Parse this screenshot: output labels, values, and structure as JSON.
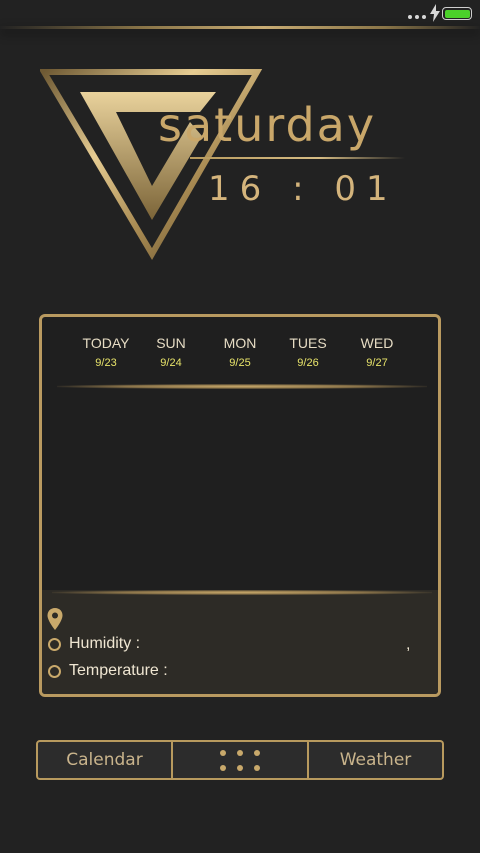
{
  "status_bar": {
    "battery_color": "#4bd12a",
    "charging_icon": "bolt-icon"
  },
  "widget": {
    "day": "saturday",
    "time": "16 : 01",
    "accent_color": "#c9a76a"
  },
  "forecast": {
    "days": [
      {
        "name": "TODAY",
        "date": "9/23"
      },
      {
        "name": "SUN",
        "date": "9/24"
      },
      {
        "name": "MON",
        "date": "9/25"
      },
      {
        "name": "TUES",
        "date": "9/26"
      },
      {
        "name": "WED",
        "date": "9/27"
      }
    ],
    "date_color": "#e8e46a"
  },
  "weather_info": {
    "location_icon": "location-pin-icon",
    "humidity_label": "Humidity :",
    "temperature_label": "Temperature :",
    "separator": ","
  },
  "nav": {
    "calendar_label": "Calendar",
    "apps_icon": "apps-grid-icon",
    "weather_label": "Weather"
  }
}
